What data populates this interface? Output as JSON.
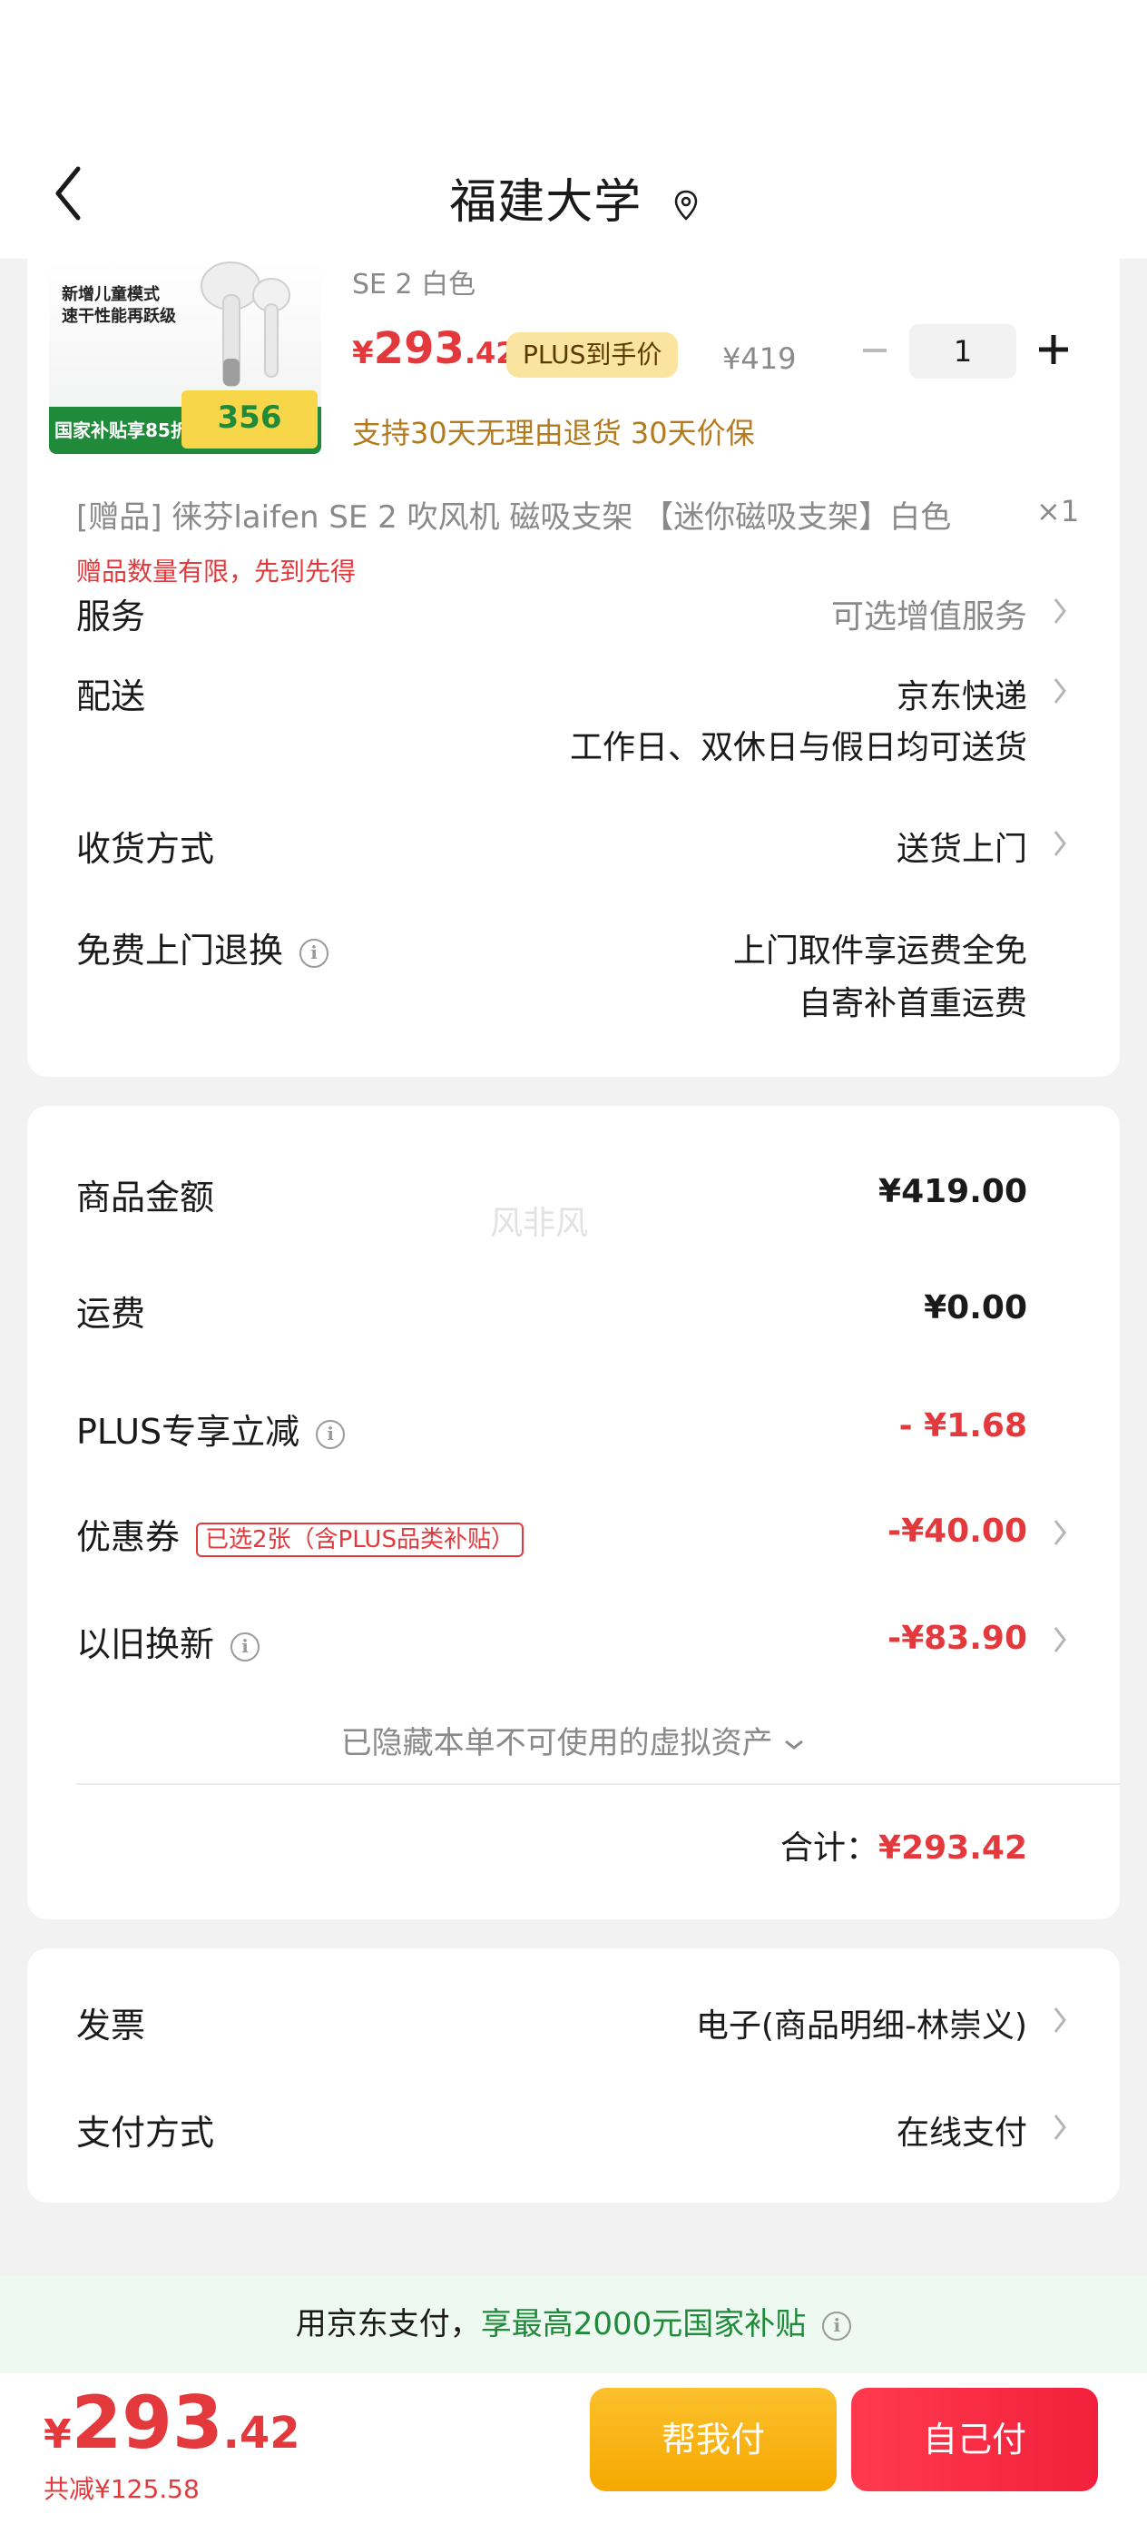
{
  "header": {
    "title": "福建大学",
    "back_icon": "chevron-left-icon",
    "location_icon": "location-pin-icon"
  },
  "product": {
    "image_lines": [
      "新增儿童模式",
      "速干性能再跃级"
    ],
    "image_subsidy": "国家补贴享85折",
    "image_price": "356",
    "spec": "SE 2 白色",
    "price_symbol": "¥",
    "price_int": "293",
    "price_dec": ".42",
    "plus_tag": "PLUS到手价",
    "original_price": "¥419",
    "quantity": "1",
    "promise": "支持30天无理由退货  30天价保",
    "gift": "[赠品] 徕芬laifen SE 2 吹风机 磁吸支架 【迷你磁吸支架】白色",
    "gift_qty": "×1",
    "gift_note": "赠品数量有限，先到先得"
  },
  "service": {
    "label": "服务",
    "value": "可选增值服务"
  },
  "delivery": {
    "label": "配送",
    "value": "京东快递",
    "note": "工作日、双休日与假日均可送货"
  },
  "receive": {
    "label": "收货方式",
    "value": "送货上门"
  },
  "return": {
    "label": "免费上门退换",
    "line1": "上门取件享运费全免",
    "line2": "自寄补首重运费"
  },
  "summary": {
    "goods_label": "商品金额",
    "goods_value": "¥419.00",
    "shipping_label": "运费",
    "shipping_value": "¥0.00",
    "plus_label": "PLUS专享立减",
    "plus_value": "- ¥1.68",
    "coupon_label": "优惠券",
    "coupon_tag": "已选2张（含PLUS品类补贴）",
    "coupon_value": "-¥40.00",
    "tradein_label": "以旧换新",
    "tradein_value": "-¥83.90",
    "hidden_assets": "已隐藏本单不可使用的虚拟资产",
    "total_label": "合计：",
    "total_value": "¥293.42",
    "watermark": "风非风"
  },
  "invoice": {
    "label": "发票",
    "value": "电子(商品明细-林崇义)"
  },
  "payment": {
    "label": "支付方式",
    "value": "在线支付"
  },
  "promo_bar": {
    "text": "用京东支付，",
    "highlight": "享最高2000元国家补贴"
  },
  "footer": {
    "price_symbol": "¥",
    "price_int": "293",
    "price_dec": ".42",
    "saved": "共减¥125.58",
    "help_pay": "帮我付",
    "self_pay": "自己付"
  },
  "colors": {
    "accent_red": "#e4393c",
    "green": "#1f8a3a",
    "gold": "#b37a1e"
  }
}
